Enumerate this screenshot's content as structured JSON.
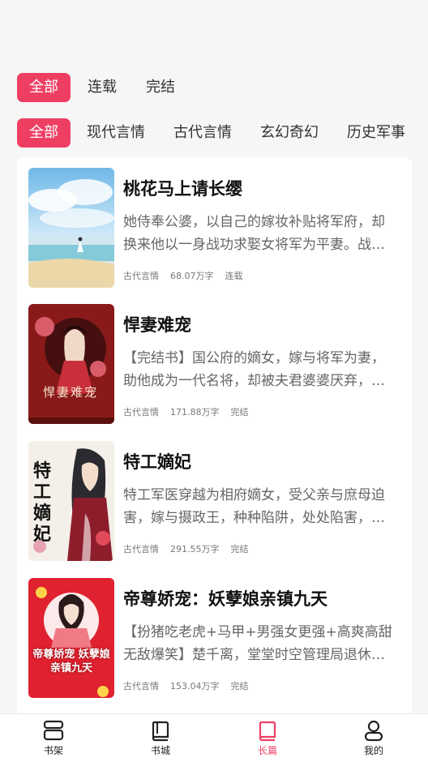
{
  "status_filters": [
    "全部",
    "连载",
    "完结"
  ],
  "genre_filters": [
    "全部",
    "现代言情",
    "古代言情",
    "玄幻奇幻",
    "历史军事"
  ],
  "books": [
    {
      "title": "桃花马上请长缨",
      "desc": "她侍奉公婆，以自己的嫁妆补贴将军府，却换来他以一身战功求娶女将军为平妻。战神将军娶了女将军，她成了下堂妇",
      "genre": "古代言情",
      "words": "68.07万字",
      "status": "连载"
    },
    {
      "title": "悍妻难宠",
      "desc": "【完结书】国公府的嫡女，嫁与将军为妻，助他成为一代名将，却被夫君婆婆厌弃，夫君另娶",
      "genre": "古代言情",
      "words": "171.88万字",
      "status": "完结",
      "cover_text": "悍妻难宠"
    },
    {
      "title": "特工嫡妃",
      "desc": "特工军医穿越为相府嫡女，受父亲与庶母迫害，嫁与摄政王，种种陷阱，处处陷害，步步为营",
      "genre": "古代言情",
      "words": "291.55万字",
      "status": "完结",
      "cover_text": "特工嫡妃"
    },
    {
      "title": "帝尊娇宠：妖孽娘亲镇九天",
      "desc": "【扮猪吃老虎+马甲+男强女更强+高爽高甜无敌爆笑】楚千离，堂堂时空管理局退休人员",
      "genre": "古代言情",
      "words": "153.04万字",
      "status": "完结",
      "cover_text": "帝尊娇宠 妖孽娘亲镇九天"
    }
  ],
  "tabbar": [
    {
      "label": "书架",
      "icon": "bookshelf-icon"
    },
    {
      "label": "书城",
      "icon": "book-icon"
    },
    {
      "label": "长篇",
      "icon": "book-icon",
      "active": true
    },
    {
      "label": "我的",
      "icon": "user-icon"
    }
  ],
  "colors": {
    "accent": "#ee3f63",
    "background": "#f6f6f7"
  }
}
